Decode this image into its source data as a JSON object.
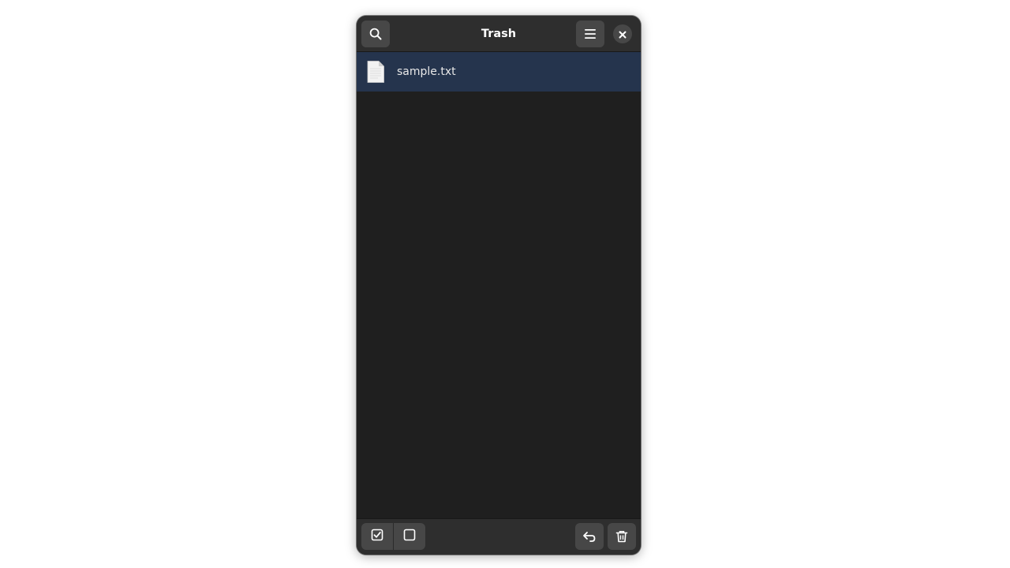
{
  "window": {
    "title": "Trash"
  },
  "header": {
    "search_icon": "search-icon",
    "menu_icon": "hamburger-menu-icon",
    "close_icon": "close-icon"
  },
  "files": [
    {
      "name": "sample.txt",
      "icon": "text-file-icon",
      "selected": true
    }
  ],
  "bottom_bar": {
    "select_all_icon": "checkbox-checked-icon",
    "select_none_icon": "checkbox-empty-icon",
    "restore_icon": "undo-arrow-icon",
    "delete_icon": "trash-icon"
  },
  "colors": {
    "window_bg": "#1f1f1f",
    "headerbar_bg": "#2e2e2e",
    "button_bg": "#474747",
    "selected_row_bg": "#25344d"
  }
}
